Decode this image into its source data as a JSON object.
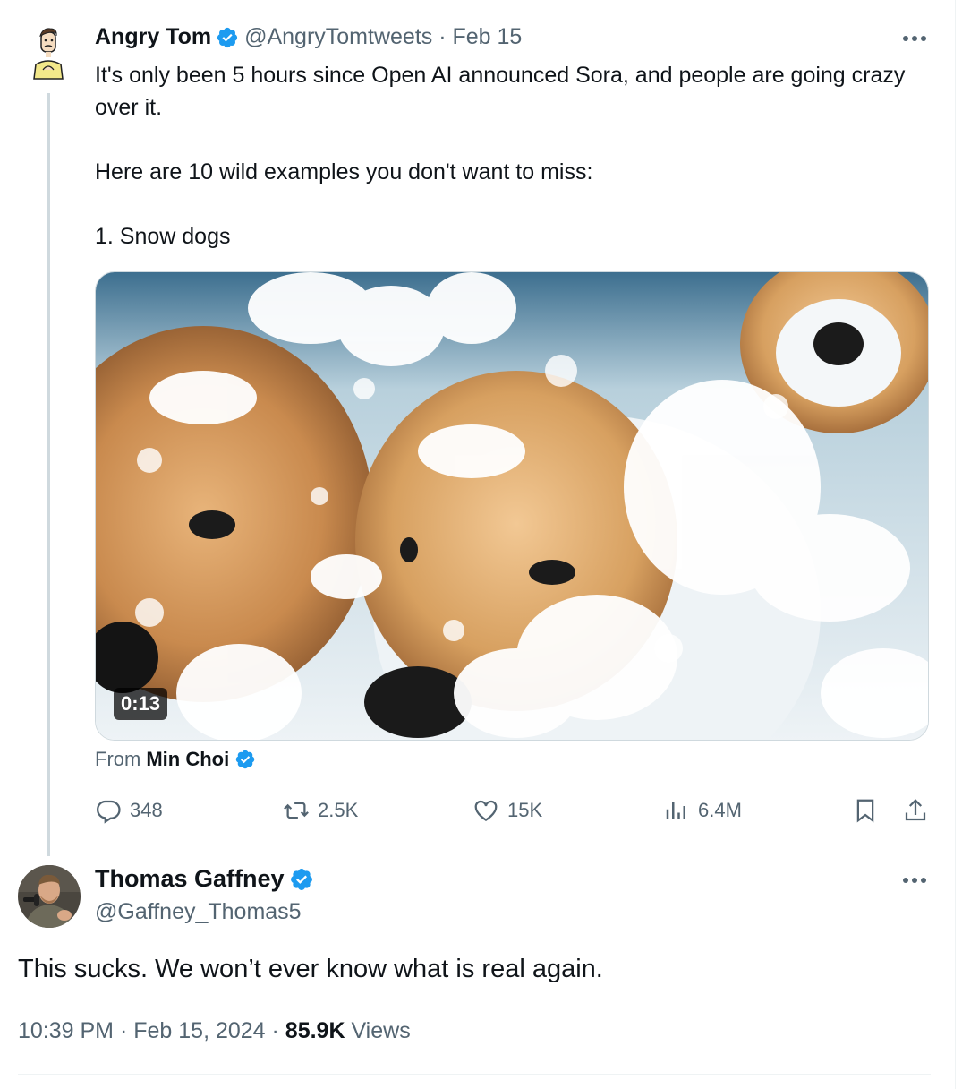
{
  "thread_tweet": {
    "author_name": "Angry Tom",
    "author_handle": "@AngryTomtweets",
    "date_sep": " · ",
    "date": "Feb 15",
    "text_lines": [
      "It's only been 5 hours since Open AI announced Sora, and people are going crazy over it.",
      "Here are 10 wild examples you don't want to miss:",
      "1. Snow dogs"
    ],
    "media": {
      "duration": "0:13"
    },
    "attribution": {
      "prefix": "From",
      "source_name": "Min Choi"
    },
    "actions": {
      "replies": "348",
      "reposts": "2.5K",
      "likes": "15K",
      "views": "6.4M"
    }
  },
  "reply_tweet": {
    "author_name": "Thomas Gaffney",
    "author_handle": "@Gaffney_Thomas5",
    "text": "This sucks. We won’t ever know what is real again.",
    "time": "10:39 PM",
    "sep1": " · ",
    "date": "Feb 15, 2024",
    "sep2": " · ",
    "views_count": "85.9K",
    "views_label": " Views"
  },
  "colors": {
    "verified": "#1d9bf0",
    "secondary_text": "#536471",
    "primary_text": "#0f1419"
  },
  "icons": [
    "more-icon",
    "verified-badge-icon",
    "reply-icon",
    "repost-icon",
    "like-icon",
    "views-icon",
    "bookmark-icon",
    "share-icon"
  ]
}
